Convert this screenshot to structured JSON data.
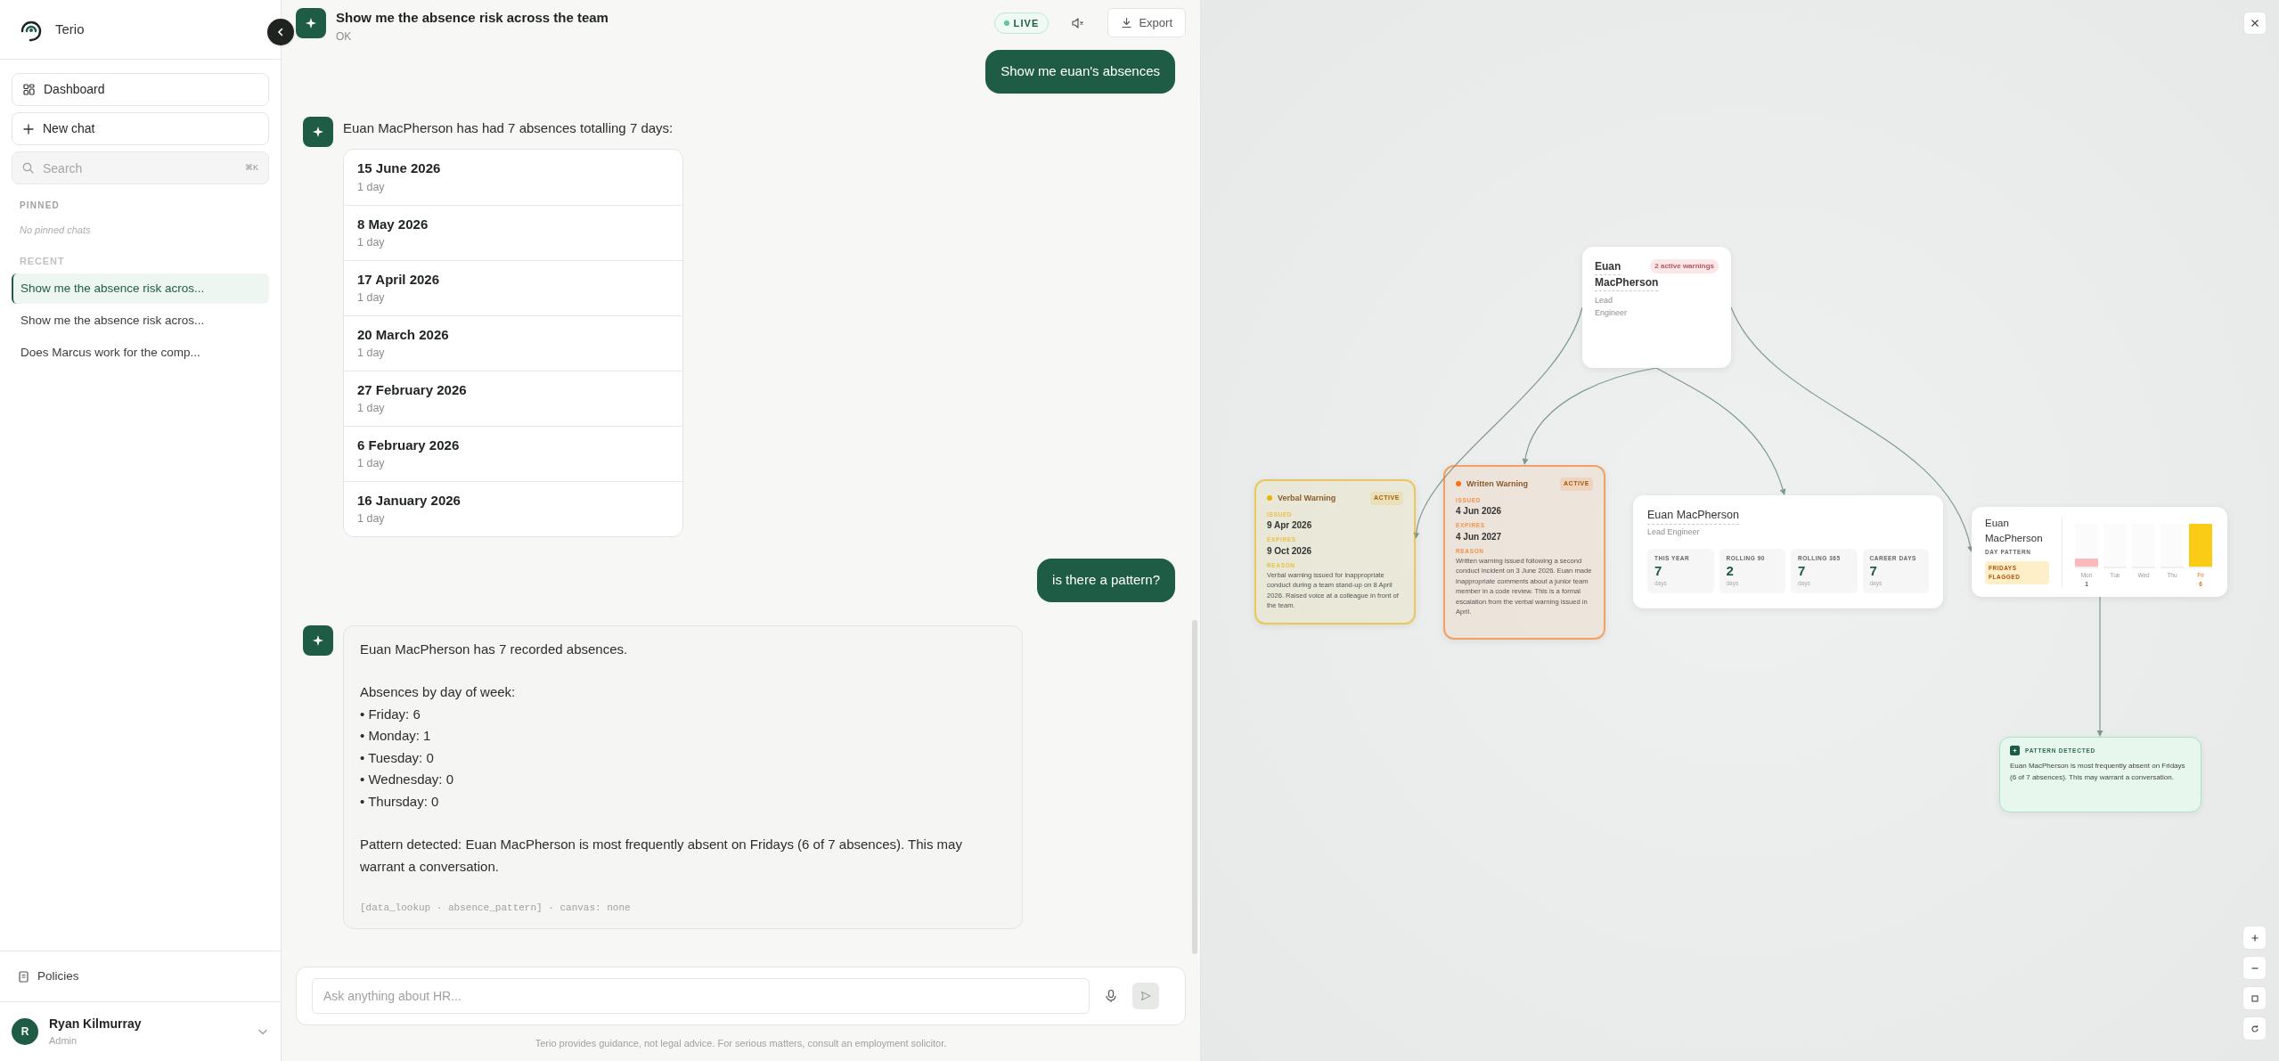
{
  "sidebar": {
    "brand": "Terio",
    "nav": [
      {
        "kind": "dashboard",
        "label": "Dashboard"
      },
      {
        "kind": "new",
        "label": "New chat"
      }
    ],
    "search": {
      "placeholder": "Search",
      "shortcut": "⌘K"
    },
    "pinned": {
      "heading": "PINNED",
      "empty": "No pinned chats"
    },
    "recent": {
      "heading": "RECENT",
      "items": [
        {
          "label": "Show me the absence risk acros...",
          "selected": true
        },
        {
          "label": "Show me the absence risk acros...",
          "selected": false
        },
        {
          "label": "Does Marcus work for the comp...",
          "selected": false
        }
      ]
    },
    "footer_link": "Policies",
    "user": {
      "initial": "R",
      "name": "Ryan Kilmurray",
      "role": "Admin"
    }
  },
  "chat": {
    "title": "Show me the absence risk across the team",
    "status": "OK",
    "live": "LIVE",
    "export": "Export",
    "messages": [
      {
        "kind": "user",
        "text": "Show me euan's absences"
      },
      {
        "kind": "list",
        "text": "Euan MacPherson has had 7 absences totalling 7 days:",
        "items": [
          {
            "date": "15 June 2026",
            "duration": "1 day"
          },
          {
            "date": "8 May 2026",
            "duration": "1 day"
          },
          {
            "date": "17 April 2026",
            "duration": "1 day"
          },
          {
            "date": "20 March 2026",
            "duration": "1 day"
          },
          {
            "date": "27 February 2026",
            "duration": "1 day"
          },
          {
            "date": "6 February 2026",
            "duration": "1 day"
          },
          {
            "date": "16 January 2026",
            "duration": "1 day"
          }
        ]
      },
      {
        "kind": "user",
        "text": "is there a pattern?"
      },
      {
        "kind": "text",
        "blocks": [
          [
            "Euan MacPherson has 7 recorded absences."
          ],
          [
            "Absences by day of week:",
            "• Friday: 6",
            "• Monday: 1",
            "• Tuesday: 0",
            "• Wednesday: 0",
            "• Thursday: 0"
          ],
          [
            "Pattern detected: Euan MacPherson is most frequently absent on Fridays (6 of 7 absences). This may warrant a conversation."
          ]
        ],
        "meta": "[data_lookup · absence_pattern] · canvas: none"
      }
    ],
    "input": {
      "placeholder": "Ask anything about HR..."
    },
    "disclaimer": "Terio provides guidance, not legal advice. For serious matters, consult an employment solicitor."
  },
  "canvas": {
    "nodes": [
      {
        "kind": "employee",
        "name_lines": [
          "Euan",
          "MacPherson"
        ],
        "role": "Lead Engineer",
        "badge": "2 active warnings"
      },
      {
        "kind": "warning",
        "title": "Verbal Warning",
        "status": "ACTIVE",
        "color": "#eab308",
        "fields": [
          {
            "label": "ISSUED",
            "value": "9 Apr 2026"
          },
          {
            "label": "EXPIRES",
            "value": "9 Oct 2026"
          },
          {
            "label": "REASON",
            "value": "Verbal warning issued for inappropriate conduct during a team stand-up on 8 April 2026. Raised voice at a colleague in front of the team."
          }
        ]
      },
      {
        "kind": "warning",
        "title": "Written Warning",
        "status": "ACTIVE",
        "color": "#f97316",
        "fields": [
          {
            "label": "ISSUED",
            "value": "4 Jun 2026"
          },
          {
            "label": "EXPIRES",
            "value": "4 Jun 2027"
          },
          {
            "label": "REASON",
            "value": "Written warning issued following a second conduct incident on 3 June 2026. Euan made inappropriate comments about a junior team member in a code review. This is a formal escalation from the verbal warning issued in April."
          }
        ]
      },
      {
        "kind": "stats",
        "name": "Euan MacPherson",
        "role": "Lead Engineer",
        "stats": [
          {
            "label": "THIS YEAR",
            "value": "7",
            "unit": "days"
          },
          {
            "label": "ROLLING 90",
            "value": "2",
            "unit": "days"
          },
          {
            "label": "ROLLING 365",
            "value": "7",
            "unit": "days"
          },
          {
            "label": "CAREER DAYS",
            "value": "7",
            "unit": "days"
          }
        ]
      },
      {
        "kind": "day_pattern",
        "name": "Euan MacPherson",
        "subtitle": "DAY PATTERN",
        "flag": "FRIDAYS FLAGGED",
        "days": [
          {
            "label": "Mon",
            "count": "1",
            "level": 0.2,
            "flagged": false
          },
          {
            "label": "Tue",
            "level": 0,
            "flagged": false
          },
          {
            "label": "Wed",
            "level": 0,
            "flagged": false
          },
          {
            "label": "Thu",
            "level": 0,
            "flagged": false
          },
          {
            "label": "Fri",
            "count": "6",
            "level": 1,
            "flagged": true
          }
        ]
      },
      {
        "kind": "insight",
        "title": "PATTERN DETECTED",
        "text": "Euan MacPherson is most frequently absent on Fridays (6 of 7 absences). This may warrant a conversation."
      }
    ]
  }
}
